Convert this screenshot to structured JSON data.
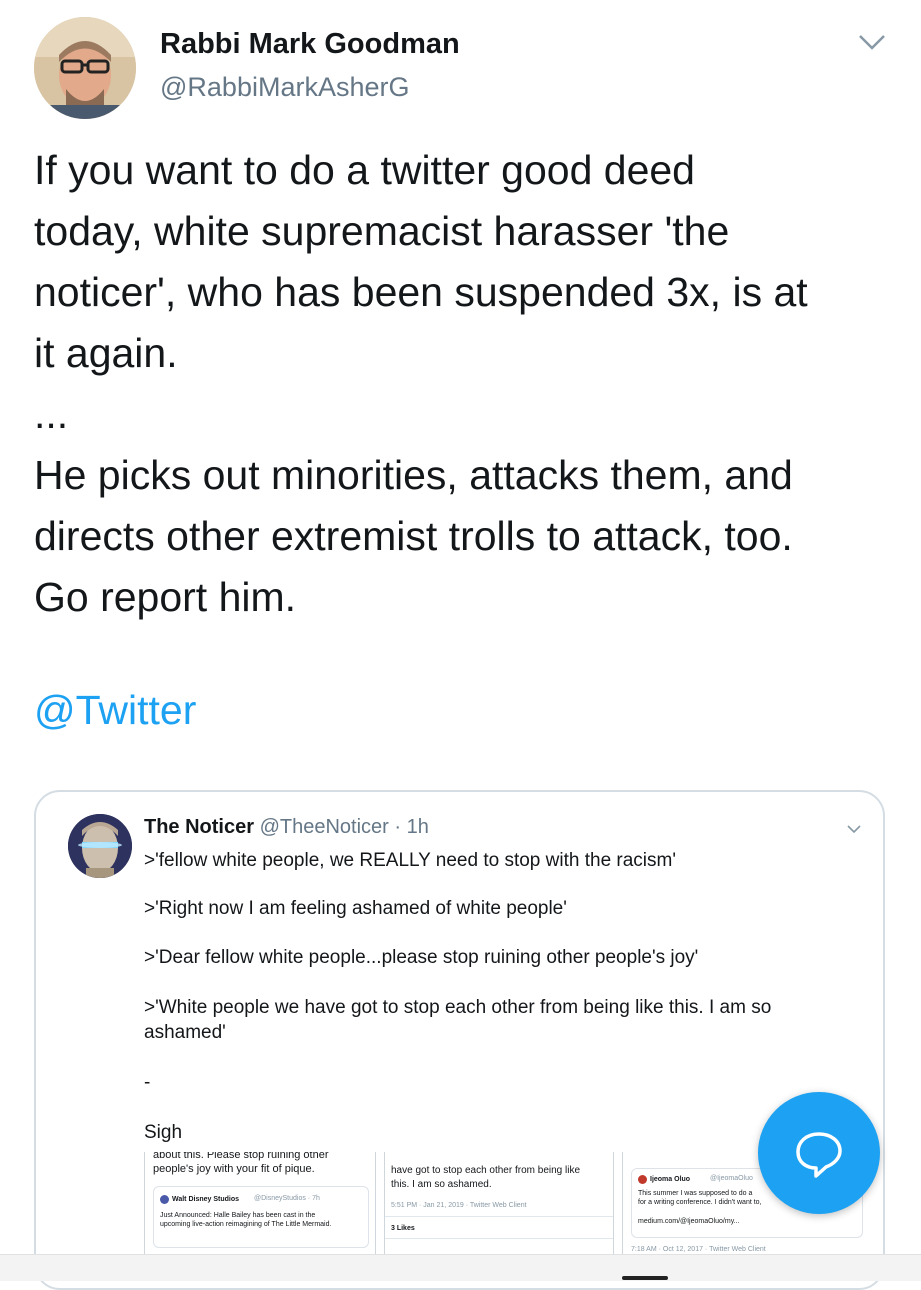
{
  "tweet": {
    "author_name": "Rabbi Mark Goodman",
    "author_handle": "@RabbiMarkAsherG",
    "text": "If you want to do a twitter good deed\ntoday, white supremacist harasser 'the\nnoticer', who has been suspended 3x, is at\nit again.\n...\nHe picks out minorities, attacks them, and\ndirects other extremist trolls to attack, too.\nGo report him.",
    "mention": "@Twitter"
  },
  "quoted": {
    "name": "The Noticer",
    "handle": "@TheeNoticer",
    "time": "· 1h",
    "lines": [
      ">'fellow white people, we REALLY need to stop with the racism'",
      ">'Right now I am feeling ashamed of white people'",
      ">'Dear fellow white people...please stop ruining other people's joy'",
      ">'White people we have got to stop each other from being like this. I am so",
      "ashamed'",
      "-",
      "Sigh"
    ],
    "screens": {
      "left": {
        "line1": "about this. Please stop ruining other",
        "line2": "people's joy with your fit of pique.",
        "sub_name": "Walt Disney Studios",
        "sub_handle": "@DisneyStudios · 7h",
        "sub_line1": "Just Announced: Halle Bailey has been cast in the",
        "sub_line2": "upcoming live-action reimagining of The Little Mermaid."
      },
      "middle": {
        "line1": "have got to stop each other from being like",
        "line2": "this. I am so ashamed.",
        "meta": "5:51 PM · Jan 21, 2019 · Twitter Web Client",
        "likes": "3 Likes"
      },
      "right": {
        "name": "Ijeoma Oluo",
        "handle": "@IjeomaOluo",
        "line1": "This summer I was supposed to do a",
        "line2": "for a writing conference. I didn't want to,",
        "link": "medium.com/@IjeomaOluo/my...",
        "meta": "7:18 AM · Oct 12, 2017 · Twitter Web Client"
      }
    }
  },
  "colors": {
    "accent": "#1da1f2",
    "secondary_text": "#657786",
    "border": "#d4dde4"
  },
  "icons": {
    "more": "chevron-down-icon",
    "compose": "compose-reply-icon"
  }
}
